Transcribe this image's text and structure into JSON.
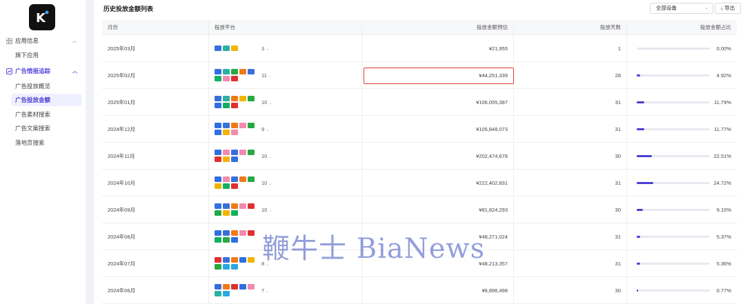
{
  "app": {
    "logo_letter": "K"
  },
  "sidebar": {
    "groups": [
      {
        "label": "应用信息",
        "icon": "grid-icon",
        "expanded": false
      },
      {
        "label": "广告情报追踪",
        "icon": "chart-icon",
        "expanded": true
      }
    ],
    "items": [
      {
        "label": "旗下应用"
      },
      {
        "label": "广告投放概览"
      },
      {
        "label": "广告投放金额"
      },
      {
        "label": "广告素材搜索"
      },
      {
        "label": "广告文案搜索"
      },
      {
        "label": "落地页搜索"
      }
    ]
  },
  "main": {
    "title": "历史投放金额列表",
    "device_select": "全部设备",
    "export_label": "导出",
    "columns": [
      "月份",
      "投放平台",
      "投放金额预估",
      "投放天数",
      "投放金额占比"
    ],
    "rows": [
      {
        "month": "2025年03月",
        "platform_count": "3",
        "amount": "¥21,955",
        "days": "1",
        "share": "0.00%",
        "share_value": 0.0,
        "icons": [
          "#3a6fd8",
          "#2ab0a4",
          "#f2b400"
        ]
      },
      {
        "month": "2025年02月",
        "platform_count": "11",
        "amount": "¥44,251,339",
        "days": "28",
        "share": "4.92%",
        "share_value": 4.92,
        "highlight": true,
        "icons": [
          "#2f6fe0",
          "#2ab0a4",
          "#28a745",
          "#f07a1a",
          "#3a6fd8",
          "#10b060",
          "#f08ab0",
          "#e03030"
        ]
      },
      {
        "month": "2025年01月",
        "platform_count": "10",
        "amount": "¥106,055,387",
        "days": "31",
        "share": "11.79%",
        "share_value": 11.79,
        "icons": [
          "#3a6fd8",
          "#2ab0a4",
          "#f07a1a",
          "#f2b400",
          "#28a745",
          "#2f6fe0",
          "#10b060",
          "#e03030"
        ]
      },
      {
        "month": "2024年12月",
        "platform_count": "9",
        "amount": "¥105,848,073",
        "days": "31",
        "share": "11.77%",
        "share_value": 11.77,
        "icons": [
          "#2f6fe0",
          "#3a6fd8",
          "#f07a1a",
          "#f08ab0",
          "#28a745",
          "#2f6fe0",
          "#f2b400",
          "#f08ab0"
        ]
      },
      {
        "month": "2024年11月",
        "platform_count": "10",
        "amount": "¥202,474,678",
        "days": "30",
        "share": "22.51%",
        "share_value": 22.51,
        "icons": [
          "#2f6fe0",
          "#f08ab0",
          "#3a6fd8",
          "#f08ab0",
          "#28a745",
          "#e03030",
          "#f2b400",
          "#2f6fe0"
        ]
      },
      {
        "month": "2024年10月",
        "platform_count": "10",
        "amount": "¥222,402,831",
        "days": "31",
        "share": "24.72%",
        "share_value": 24.72,
        "icons": [
          "#2f6fe0",
          "#f08ab0",
          "#3a6fd8",
          "#f07a1a",
          "#28a745",
          "#f2b400",
          "#10b060",
          "#e03030"
        ]
      },
      {
        "month": "2024年09月",
        "platform_count": "10",
        "amount": "¥81,824,293",
        "days": "30",
        "share": "9.10%",
        "share_value": 9.1,
        "icons": [
          "#2f6fe0",
          "#3a6fd8",
          "#f07a1a",
          "#f08ab0",
          "#e03030",
          "#28a745",
          "#f2b400",
          "#10b060"
        ]
      },
      {
        "month": "2024年08月",
        "platform_count": "",
        "amount": "¥48,271,024",
        "days": "31",
        "share": "5.37%",
        "share_value": 5.37,
        "icons": [
          "#2f6fe0",
          "#3a6fd8",
          "#f07a1a",
          "#f08ab0",
          "#e03030",
          "#10b060",
          "#28a745",
          "#2f6fe0"
        ]
      },
      {
        "month": "2024年07月",
        "platform_count": "8",
        "amount": "¥48,213,357",
        "days": "31",
        "share": "5.36%",
        "share_value": 5.36,
        "icons": [
          "#e03030",
          "#3a6fd8",
          "#f07a1a",
          "#2f6fe0",
          "#f2b400",
          "#28a745",
          "#2aa8e0",
          "#2aa8e0"
        ]
      },
      {
        "month": "2024年06月",
        "platform_count": "7",
        "amount": "¥6,896,498",
        "days": "30",
        "share": "0.77%",
        "share_value": 0.77,
        "icons": [
          "#3a6fd8",
          "#f07a1a",
          "#e03030",
          "#2f6fe0",
          "#f08ab0",
          "#2ab0a4",
          "#2aa8e0"
        ]
      }
    ]
  },
  "watermark": "鞭牛士 BiaNews",
  "colors": {
    "accent": "#4a3fd1",
    "highlight": "#e53935"
  }
}
